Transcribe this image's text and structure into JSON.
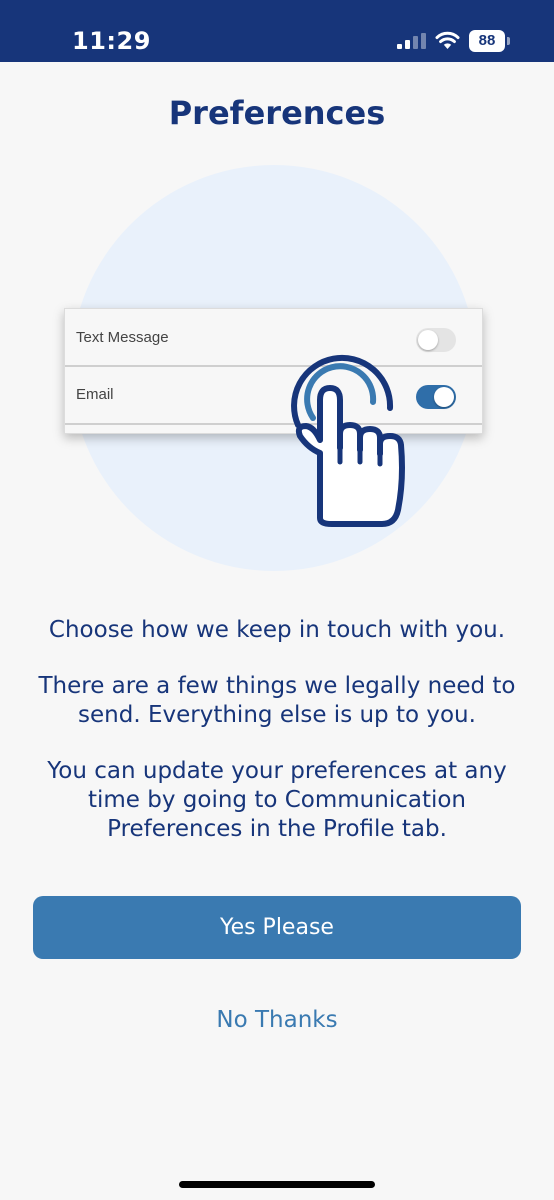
{
  "status_bar": {
    "time": "11:29",
    "battery_level": "88",
    "icons": [
      "signal-icon",
      "wifi-icon",
      "battery-icon"
    ]
  },
  "page": {
    "title": "Preferences"
  },
  "illustration": {
    "rows": [
      {
        "label": "Text Message",
        "toggle_on": false
      },
      {
        "label": "Email",
        "toggle_on": true
      }
    ],
    "icon": "hand-pointer-tap-icon"
  },
  "content": {
    "line1": "Choose how we keep in touch with you.",
    "line2": "There are a few things we legally need to send. Everything else is up to you.",
    "line3": "You can update your preferences at any time by going to Communication Preferences in the Profile tab."
  },
  "actions": {
    "yes_label": "Yes Please",
    "no_label": "No Thanks"
  },
  "colors": {
    "header_bg": "#17357a",
    "title_text": "#17357a",
    "accent": "#3a7ab1",
    "circle_bg": "#e9f1fb",
    "page_bg": "#f7f7f7"
  }
}
